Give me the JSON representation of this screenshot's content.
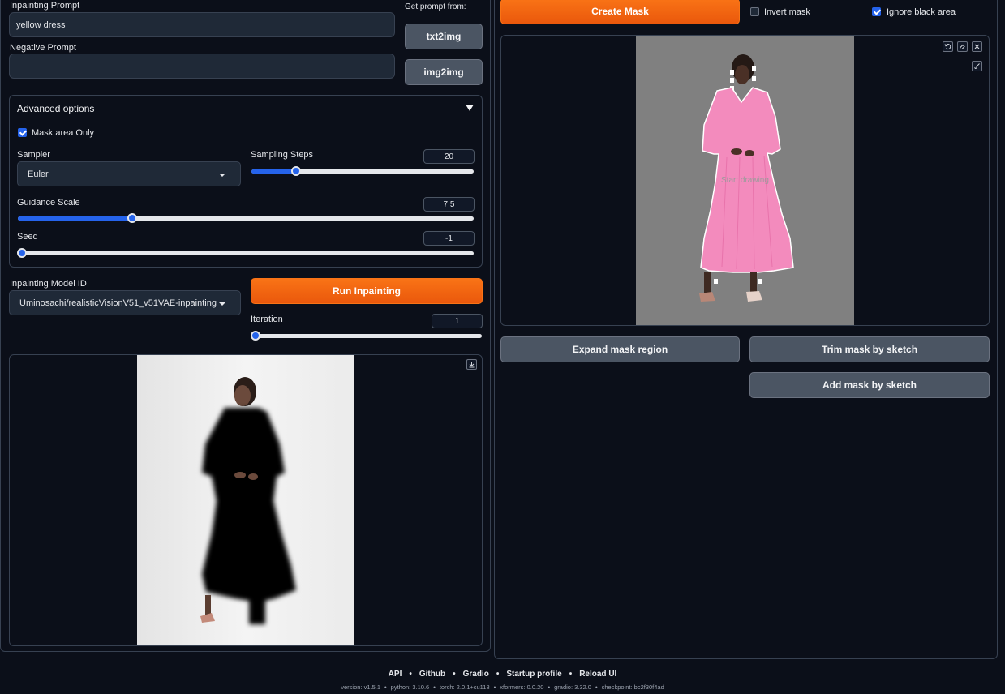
{
  "prompt": {
    "inpainting_label": "Inpainting Prompt",
    "inpainting_value": "yellow dress",
    "negative_label": "Negative Prompt",
    "negative_value": "",
    "get_prompt_from_label": "Get prompt from:",
    "txt2img_label": "txt2img",
    "img2img_label": "img2img"
  },
  "advanced": {
    "title": "Advanced options",
    "mask_area_only_label": "Mask area Only",
    "mask_area_only_checked": true,
    "sampler_label": "Sampler",
    "sampler_value": "Euler",
    "sampling_steps_label": "Sampling Steps",
    "sampling_steps_value": "20",
    "sampling_steps_fraction": 0.2,
    "guidance_label": "Guidance Scale",
    "guidance_value": "7.5",
    "guidance_fraction": 0.25,
    "seed_label": "Seed",
    "seed_value": "-1",
    "seed_fraction": 0.0
  },
  "model": {
    "label": "Inpainting Model ID",
    "value": "Uminosachi/realisticVisionV51_v51VAE-inpainting",
    "run_label": "Run Inpainting",
    "iteration_label": "Iteration",
    "iteration_value": "1",
    "iteration_fraction": 0.0
  },
  "mask": {
    "create_label": "Create Mask",
    "invert_label": "Invert mask",
    "invert_checked": false,
    "ignore_black_label": "Ignore black area",
    "ignore_black_checked": true,
    "canvas_hint": "Start drawing",
    "expand_label": "Expand mask region",
    "trim_label": "Trim mask by sketch",
    "add_label": "Add mask by sketch"
  },
  "footer": {
    "links": [
      "API",
      "Github",
      "Gradio",
      "Startup profile",
      "Reload UI"
    ],
    "version": "version: v1.5.1",
    "python": "python: 3.10.6",
    "torch": "torch: 2.0.1+cu118",
    "xformers": "xformers: 0.0.20",
    "gradio": "gradio: 3.32.0",
    "checkpoint": "checkpoint: bc2f30f4ad"
  },
  "colors": {
    "background": "#0b0f19",
    "accent_orange": "#f97316",
    "accent_blue": "#2563eb",
    "mask_pink": "#f38bbd"
  },
  "icons": [
    "chevron-down-icon",
    "undo-icon",
    "eraser-icon",
    "close-icon",
    "brush-icon",
    "download-icon"
  ]
}
